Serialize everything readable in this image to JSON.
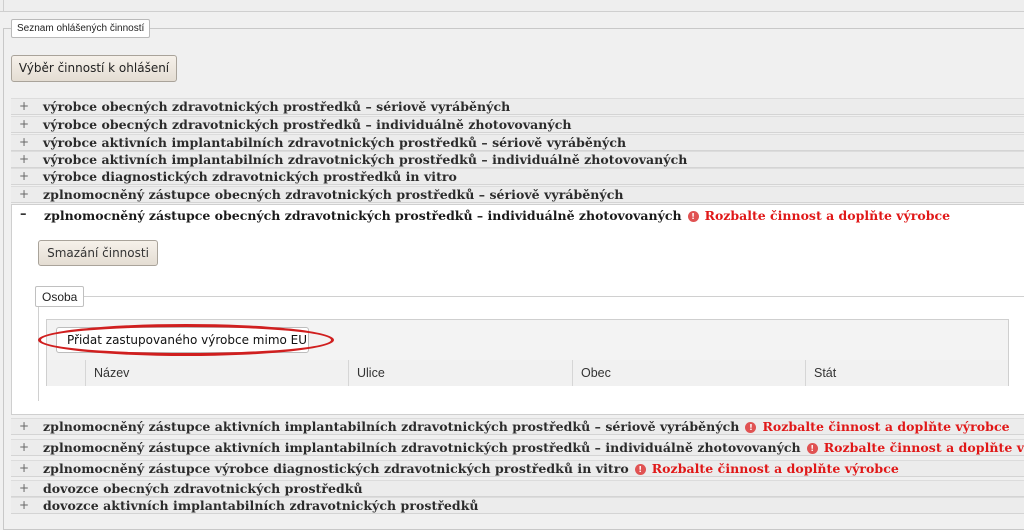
{
  "fieldset_legend": "Seznam ohlášených činností",
  "select_button": "Výběr činností k ohlášení",
  "activities_top": [
    {
      "sign": "+",
      "label": "výrobce obecných zdravotnických prostředků – sériově vyráběných"
    },
    {
      "sign": "+",
      "label": "výrobce obecných zdravotnických prostředků – individuálně zhotovovaných"
    },
    {
      "sign": "+",
      "label": "výrobce aktivních implantabilních zdravotnických prostředků – sériově vyráběných"
    },
    {
      "sign": "+",
      "label": "výrobce aktivních implantabilních zdravotnických prostředků – individuálně zhotovovaných"
    },
    {
      "sign": "+",
      "label": "výrobce diagnostických zdravotnických prostředků in vitro"
    },
    {
      "sign": "+",
      "label": "zplnomocněný zástupce obecných zdravotnických prostředků – sériově vyráběných"
    }
  ],
  "expanded": {
    "sign": "–",
    "label": "zplnomocněný zástupce obecných zdravotnických prostředků – individuálně zhotovovaných",
    "warning_icon": "!",
    "warning": "Rozbalte činnost a doplňte výrobce",
    "delete_button": "Smazání činnosti",
    "osoba_legend": "Osoba",
    "add_button": "Přidat zastupovaného výrobce mimo EU",
    "columns": [
      "",
      "Název",
      "Ulice",
      "Obec",
      "Stát"
    ]
  },
  "activities_bottom": [
    {
      "sign": "+",
      "label": "zplnomocněný zástupce aktivních implantabilních zdravotnických prostředků – sériově vyráběných",
      "warning": "Rozbalte činnost a doplňte výrobce"
    },
    {
      "sign": "+",
      "label": "zplnomocněný zástupce aktivních implantabilních zdravotnických prostředků – individuálně zhotovovaných",
      "warning": "Rozbalte činnost a doplňte výrobce"
    },
    {
      "sign": "+",
      "label": "zplnomocněný zástupce výrobce diagnostických zdravotnických prostředků in vitro",
      "warning": "Rozbalte činnost a doplňte výrobce"
    },
    {
      "sign": "+",
      "label": "dovozce obecných zdravotnických prostředků"
    },
    {
      "sign": "+",
      "label": "dovozce aktivních implantabilních zdravotnických prostředků"
    }
  ],
  "colors": {
    "warning": "#e01818",
    "highlight_ring": "#d01f1f"
  },
  "icons": {
    "warning": "exclamation-circle-icon"
  }
}
